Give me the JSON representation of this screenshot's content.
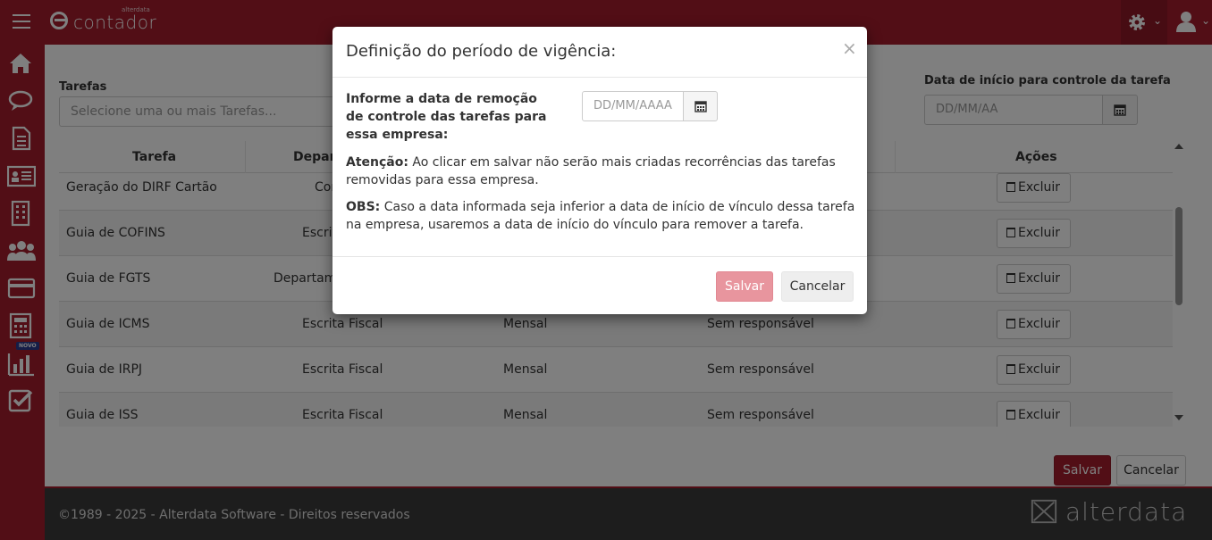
{
  "app": {
    "logo_text": "contador",
    "logo_small": "alterdata"
  },
  "colors": {
    "brand": "#a51d2d",
    "brand_dark": "#8e1826",
    "save_disabled": "#e8959e",
    "footer_bg": "#3a3a3a",
    "novo_badge": "#2b3a8f"
  },
  "sidebar": {
    "items": [
      {
        "icon": "home-icon"
      },
      {
        "icon": "chat-icon"
      },
      {
        "icon": "document-icon"
      },
      {
        "icon": "contact-card-icon"
      },
      {
        "icon": "building-icon"
      },
      {
        "icon": "users-icon"
      },
      {
        "icon": "credit-card-icon"
      },
      {
        "icon": "calculator-icon"
      },
      {
        "icon": "bar-chart-icon",
        "badge": "NOVO"
      },
      {
        "icon": "checkbox-icon"
      }
    ]
  },
  "filters": {
    "tarefas_label": "Tarefas",
    "tarefas_placeholder": "Selecione uma ou mais Tarefas...",
    "date_label": "Data de início para controle da tarefa",
    "date_placeholder": "DD/MM/AA"
  },
  "table": {
    "headers": [
      "Tarefa",
      "Depart",
      "",
      "",
      "Ações"
    ],
    "rows": [
      {
        "tarefa": "Geração do DIRF Cartão",
        "depto": "Con",
        "periodo": "",
        "responsavel": "",
        "acao": "Excluir"
      },
      {
        "tarefa": "Guia de COFINS",
        "depto": "Escrit",
        "periodo": "",
        "responsavel": "",
        "acao": "Excluir"
      },
      {
        "tarefa": "Guia de FGTS",
        "depto": "Departame",
        "periodo": "",
        "responsavel": "",
        "acao": "Excluir"
      },
      {
        "tarefa": "Guia de ICMS",
        "depto": "Escrita Fiscal",
        "periodo": "Mensal",
        "responsavel": "Sem responsável",
        "acao": "Excluir"
      },
      {
        "tarefa": "Guia de IRPJ",
        "depto": "Escrita Fiscal",
        "periodo": "Mensal",
        "responsavel": "Sem responsável",
        "acao": "Excluir"
      },
      {
        "tarefa": "Guia de ISS",
        "depto": "Escrita Fiscal",
        "periodo": "Mensal",
        "responsavel": "Sem responsável",
        "acao": "Excluir"
      }
    ]
  },
  "page_actions": {
    "save": "Salvar",
    "cancel": "Cancelar"
  },
  "footer": {
    "copyright": "©1989 - 2025 - Alterdata Software - Direitos reservados",
    "logo": "alterdata"
  },
  "modal": {
    "title": "Definição do período de vigência:",
    "close": "×",
    "field_label": "Informe a data de remoção de controle das tarefas para essa empresa:",
    "date_placeholder": "DD/MM/AAAA",
    "attention_label": "Atenção:",
    "attention_text": " Ao clicar em salvar não serão mais criadas recorrências das tarefas removidas para essa empresa.",
    "obs_label": "OBS:",
    "obs_text": " Caso a data informada seja inferior a data de início de vínculo dessa tarefa na empresa, usaremos a data de início do vínculo para remover a tarefa.",
    "save": "Salvar",
    "cancel": "Cancelar"
  }
}
